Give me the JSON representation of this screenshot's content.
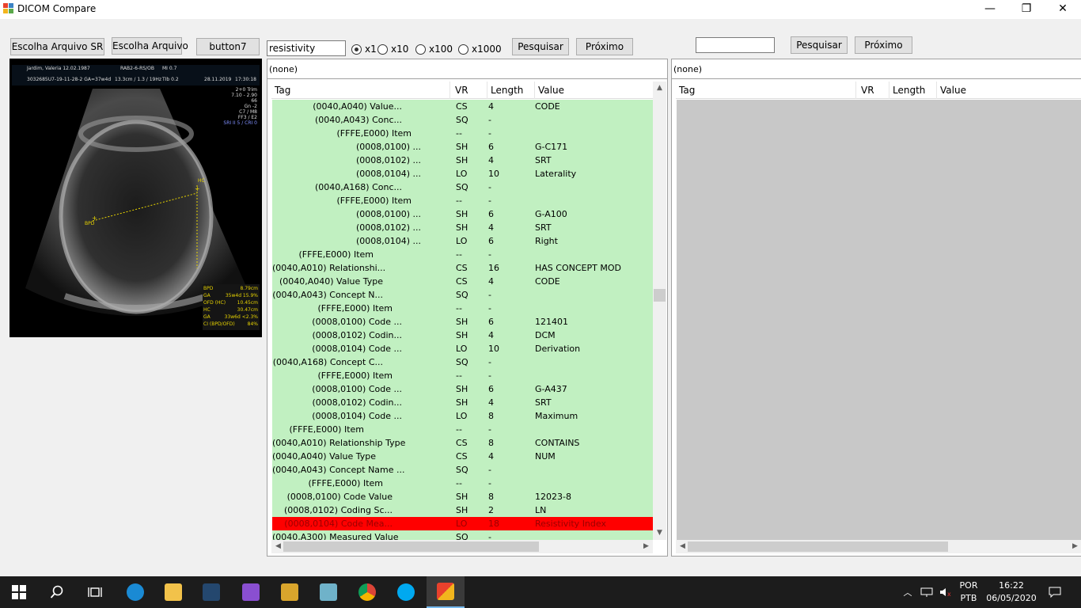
{
  "window": {
    "title": "DICOM Compare",
    "min_glyph": "—",
    "max_glyph": "❐",
    "close_glyph": "✕"
  },
  "toolbar": {
    "btn_sr": "Escolha Arquivo SR",
    "btn_file": "Escolha Arquivo",
    "btn7": "button7",
    "search_left_value": "resistivity",
    "radios": [
      {
        "label": "x1",
        "selected": true
      },
      {
        "label": "x10",
        "selected": false
      },
      {
        "label": "x100",
        "selected": false
      },
      {
        "label": "x1000",
        "selected": false
      }
    ],
    "search_left_btn": "Pesquisar",
    "next_left_btn": "Próximo",
    "search_right_value": "",
    "search_right_btn": "Pesquisar",
    "next_right_btn": "Próximo"
  },
  "ultrasound": {
    "header_line1": "Jardim, Valeria  12.02.1987",
    "header_probe": "RAB2-6-RS/OB",
    "header_mi": "MI 0.7",
    "header_line2": "3032685U7-19-11-28-2  GA=37w4d",
    "header_scan": "13.3cm / 1.3 / 19Hz",
    "header_tib": "TIb 0.2",
    "header_date": "28.11.2019",
    "header_time": "17:30:18",
    "side_labels": [
      "2+0 Trim",
      "7.10 - 2.90",
      "66",
      "Gn -2",
      "C7 / M8",
      "FF3 / E2",
      "SRI II 5 / CRI 0"
    ],
    "marker_hc": "HC",
    "marker_bpd": "BPD",
    "measurements": [
      {
        "label": "BPD",
        "value": "8.79cm"
      },
      {
        "label": "GA",
        "value": "35w4d 15.9%"
      },
      {
        "label": "OFD (HC)",
        "value": "10.45cm"
      },
      {
        "label": "HC",
        "value": "30.47cm"
      },
      {
        "label": "GA",
        "value": "33w6d <2.3%"
      },
      {
        "label": "CI (BPD/OFD)",
        "value": "84%"
      }
    ]
  },
  "left_panel": {
    "caption": "(none)",
    "columns": [
      "Tag",
      "VR",
      "Length",
      "Value"
    ],
    "rows": [
      {
        "tag": "(0040,A040)  Value...",
        "vr": "CS",
        "len": "4",
        "val": "CODE",
        "indent": 3
      },
      {
        "tag": "(0040,A043)  Conc...",
        "vr": "SQ",
        "len": "-",
        "val": "",
        "indent": 3
      },
      {
        "tag": "(FFFE,E000)  Item",
        "vr": "--",
        "len": "-",
        "val": "",
        "indent": 4
      },
      {
        "tag": "(0008,0100)  ...",
        "vr": "SH",
        "len": "6",
        "val": "G-C171",
        "indent": 5
      },
      {
        "tag": "(0008,0102)  ...",
        "vr": "SH",
        "len": "4",
        "val": "SRT",
        "indent": 5
      },
      {
        "tag": "(0008,0104)  ...",
        "vr": "LO",
        "len": "10",
        "val": "Laterality",
        "indent": 5
      },
      {
        "tag": "(0040,A168)  Conc...",
        "vr": "SQ",
        "len": "-",
        "val": "",
        "indent": 3
      },
      {
        "tag": "(FFFE,E000)  Item",
        "vr": "--",
        "len": "-",
        "val": "",
        "indent": 4
      },
      {
        "tag": "(0008,0100)  ...",
        "vr": "SH",
        "len": "6",
        "val": "G-A100",
        "indent": 5
      },
      {
        "tag": "(0008,0102)  ...",
        "vr": "SH",
        "len": "4",
        "val": "SRT",
        "indent": 5
      },
      {
        "tag": "(0008,0104)  ...",
        "vr": "LO",
        "len": "6",
        "val": "Right",
        "indent": 5
      },
      {
        "tag": "(FFFE,E000)  Item",
        "vr": "--",
        "len": "-",
        "val": "",
        "indent": 0
      },
      {
        "tag": "(0040,A010)  Relationshi...",
        "vr": "CS",
        "len": "16",
        "val": "HAS CONCEPT MOD",
        "indent": 1
      },
      {
        "tag": "(0040,A040)  Value Type",
        "vr": "CS",
        "len": "4",
        "val": "CODE",
        "indent": 1
      },
      {
        "tag": "(0040,A043)  Concept N...",
        "vr": "SQ",
        "len": "-",
        "val": "",
        "indent": 1
      },
      {
        "tag": "(FFFE,E000)  Item",
        "vr": "--",
        "len": "-",
        "val": "",
        "indent": 2
      },
      {
        "tag": "(0008,0100)  Code ...",
        "vr": "SH",
        "len": "6",
        "val": "121401",
        "indent": 3
      },
      {
        "tag": "(0008,0102)  Codin...",
        "vr": "SH",
        "len": "4",
        "val": "DCM",
        "indent": 3
      },
      {
        "tag": "(0008,0104)  Code ...",
        "vr": "LO",
        "len": "10",
        "val": "Derivation",
        "indent": 3
      },
      {
        "tag": "(0040,A168)  Concept C...",
        "vr": "SQ",
        "len": "-",
        "val": "",
        "indent": 1
      },
      {
        "tag": "(FFFE,E000)  Item",
        "vr": "--",
        "len": "-",
        "val": "",
        "indent": 2
      },
      {
        "tag": "(0008,0100)  Code ...",
        "vr": "SH",
        "len": "6",
        "val": "G-A437",
        "indent": 3
      },
      {
        "tag": "(0008,0102)  Codin...",
        "vr": "SH",
        "len": "4",
        "val": "SRT",
        "indent": 3
      },
      {
        "tag": "(0008,0104)  Code ...",
        "vr": "LO",
        "len": "8",
        "val": "Maximum",
        "indent": 3
      },
      {
        "tag": "(FFFE,E000)  Item",
        "vr": "--",
        "len": "-",
        "val": "",
        "indent": -1
      },
      {
        "tag": "(0040,A010)  Relationship Type",
        "vr": "CS",
        "len": "8",
        "val": "CONTAINS",
        "indent": 0
      },
      {
        "tag": "(0040,A040)  Value Type",
        "vr": "CS",
        "len": "4",
        "val": "NUM",
        "indent": 0
      },
      {
        "tag": "(0040,A043)  Concept Name ...",
        "vr": "SQ",
        "len": "-",
        "val": "",
        "indent": 0
      },
      {
        "tag": "(FFFE,E000)  Item",
        "vr": "--",
        "len": "-",
        "val": "",
        "indent": 1
      },
      {
        "tag": "(0008,0100)  Code Value",
        "vr": "SH",
        "len": "8",
        "val": "12023-8",
        "indent": 2
      },
      {
        "tag": "(0008,0102)  Coding Sc...",
        "vr": "SH",
        "len": "2",
        "val": "LN",
        "indent": 2
      },
      {
        "tag": "(0008,0104)  Code Mea...",
        "vr": "LO",
        "len": "18",
        "val": "Resistivity Index",
        "indent": 2,
        "selected": true
      },
      {
        "tag": "(0040,A300)  Measured Value",
        "vr": "SQ",
        "len": "-",
        "val": "",
        "indent": 0
      }
    ]
  },
  "right_panel": {
    "caption": "(none)",
    "columns": [
      "Tag",
      "VR",
      "Length",
      "Value"
    ]
  },
  "taskbar": {
    "lang_top": "POR",
    "lang_bottom": "PTB",
    "time": "16:22",
    "date": "06/05/2020"
  },
  "colors": {
    "row_green": "#c1f0c1",
    "row_selected": "#ff0000",
    "empty_grid": "#c8c8c8"
  }
}
